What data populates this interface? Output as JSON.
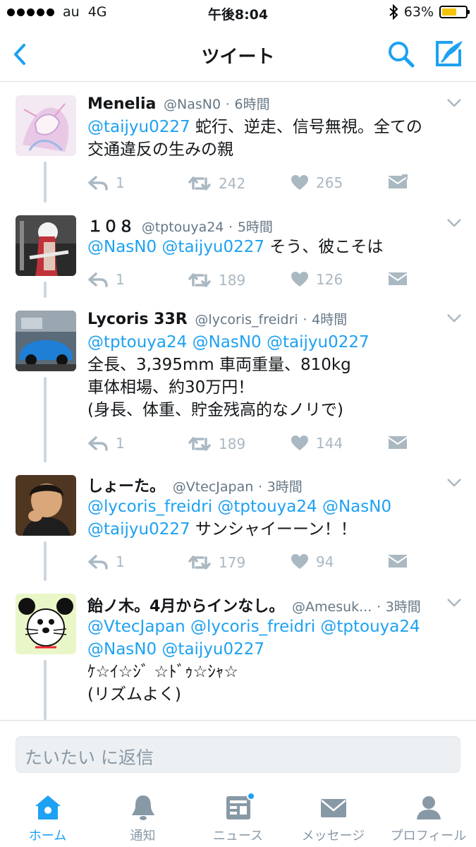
{
  "status_bar": {
    "carrier": "au",
    "network": "4G",
    "time": "午後8:04",
    "battery_percent": "63%",
    "battery_level": 0.63
  },
  "nav": {
    "title": "ツイート",
    "back_icon": "chevron-left-icon",
    "search_icon": "search-icon",
    "compose_icon": "compose-icon"
  },
  "tweets": [
    {
      "name": "Menelia",
      "handle": "@NasN0",
      "sep": "·",
      "time": "6時間",
      "body_mentions": "@taijyu0227",
      "body_text_1": " 蛇行、逆走、信号無視。全ての",
      "body_line_2": "交通違反の生みの親",
      "reply_count": "1",
      "retweet_count": "242",
      "like_count": "265"
    },
    {
      "name": "１０８",
      "handle": "@tptouya24",
      "sep": "·",
      "time": "5時間",
      "body_mentions": "@NasN0 @taijyu0227",
      "body_text_1": " そう、彼こそは",
      "reply_count": "1",
      "retweet_count": "189",
      "like_count": "126"
    },
    {
      "name": "Lycoris 33R",
      "handle": "@lycoris_freidri",
      "sep": "·",
      "time": "4時間",
      "body_mentions": "@tptouya24 @NasN0 @taijyu0227",
      "body_line_2": "全長、3,395mm 車両重量、810kg",
      "body_line_3": "車体相場、約30万円！",
      "body_line_4": "(身長、体重、貯金残高的なノリで)",
      "reply_count": "1",
      "retweet_count": "189",
      "like_count": "144"
    },
    {
      "name": "しょーた。",
      "handle": "@VtecJapan",
      "sep": "·",
      "time": "3時間",
      "body_mentions_1": "@lycoris_freidri @tptouya24 @NasN0",
      "body_mentions_2": "@taijyu0227",
      "body_text_2": " サンシャイーーン！！",
      "reply_count": "1",
      "retweet_count": "179",
      "like_count": "94"
    },
    {
      "name": "飴ノ木。4月からインなし。",
      "handle": "@Amesuk...",
      "sep": "·",
      "time": "3時間",
      "body_mentions_1": "@VtecJapan @lycoris_freidri @tptouya24",
      "body_mentions_2": "@NasN0 @taijyu0227",
      "body_line_3": "ｹ☆ｲ☆ｼﾞ ☆ﾄﾞｩ☆ｼｬ☆",
      "body_line_4": "(リズムよく)"
    }
  ],
  "reply": {
    "placeholder": "たいたい に返信"
  },
  "tabs": [
    {
      "label": "ホーム",
      "icon": "home-icon",
      "active": true
    },
    {
      "label": "通知",
      "icon": "bell-icon",
      "active": false
    },
    {
      "label": "ニュース",
      "icon": "news-icon",
      "active": false
    },
    {
      "label": "メッセージ",
      "icon": "envelope-icon",
      "active": false
    },
    {
      "label": "プロフィール",
      "icon": "person-icon",
      "active": false
    }
  ],
  "colors": {
    "accent": "#1da1f2",
    "text": "#14171a",
    "muted": "#657786",
    "action_gray": "#aab8c2",
    "battery": "#f5c400"
  }
}
